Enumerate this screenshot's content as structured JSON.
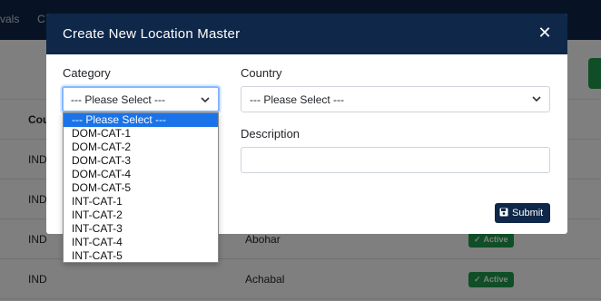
{
  "background": {
    "nav": [
      "vals",
      "C"
    ],
    "table_header": "Cou",
    "rows": [
      {
        "col1": "IND",
        "col2": "",
        "status": ""
      },
      {
        "col1": "IND",
        "col2": "",
        "status": ""
      },
      {
        "col1": "IND",
        "col2": "Abohar",
        "status": "Active"
      },
      {
        "col1": "IND",
        "col2": "Achabal",
        "status": "Active"
      }
    ]
  },
  "modal": {
    "title": "Create New Location Master",
    "category": {
      "label": "Category",
      "value": "--- Please Select ---",
      "options": [
        "--- Please Select ---",
        "DOM-CAT-1",
        "DOM-CAT-2",
        "DOM-CAT-3",
        "DOM-CAT-4",
        "DOM-CAT-5",
        "INT-CAT-1",
        "INT-CAT-2",
        "INT-CAT-3",
        "INT-CAT-4",
        "INT-CAT-5"
      ]
    },
    "country": {
      "label": "Country",
      "value": "--- Please Select ---"
    },
    "description": {
      "label": "Description",
      "value": ""
    },
    "submit_label": "Submit"
  },
  "icons": {
    "close": "close-icon",
    "chevron": "chevron-down-icon",
    "save": "floppy-disk-icon",
    "check": "check-icon"
  },
  "colors": {
    "header": "#0f2748",
    "active": "#1f9d4c",
    "selected_option": "#1a73e8"
  }
}
